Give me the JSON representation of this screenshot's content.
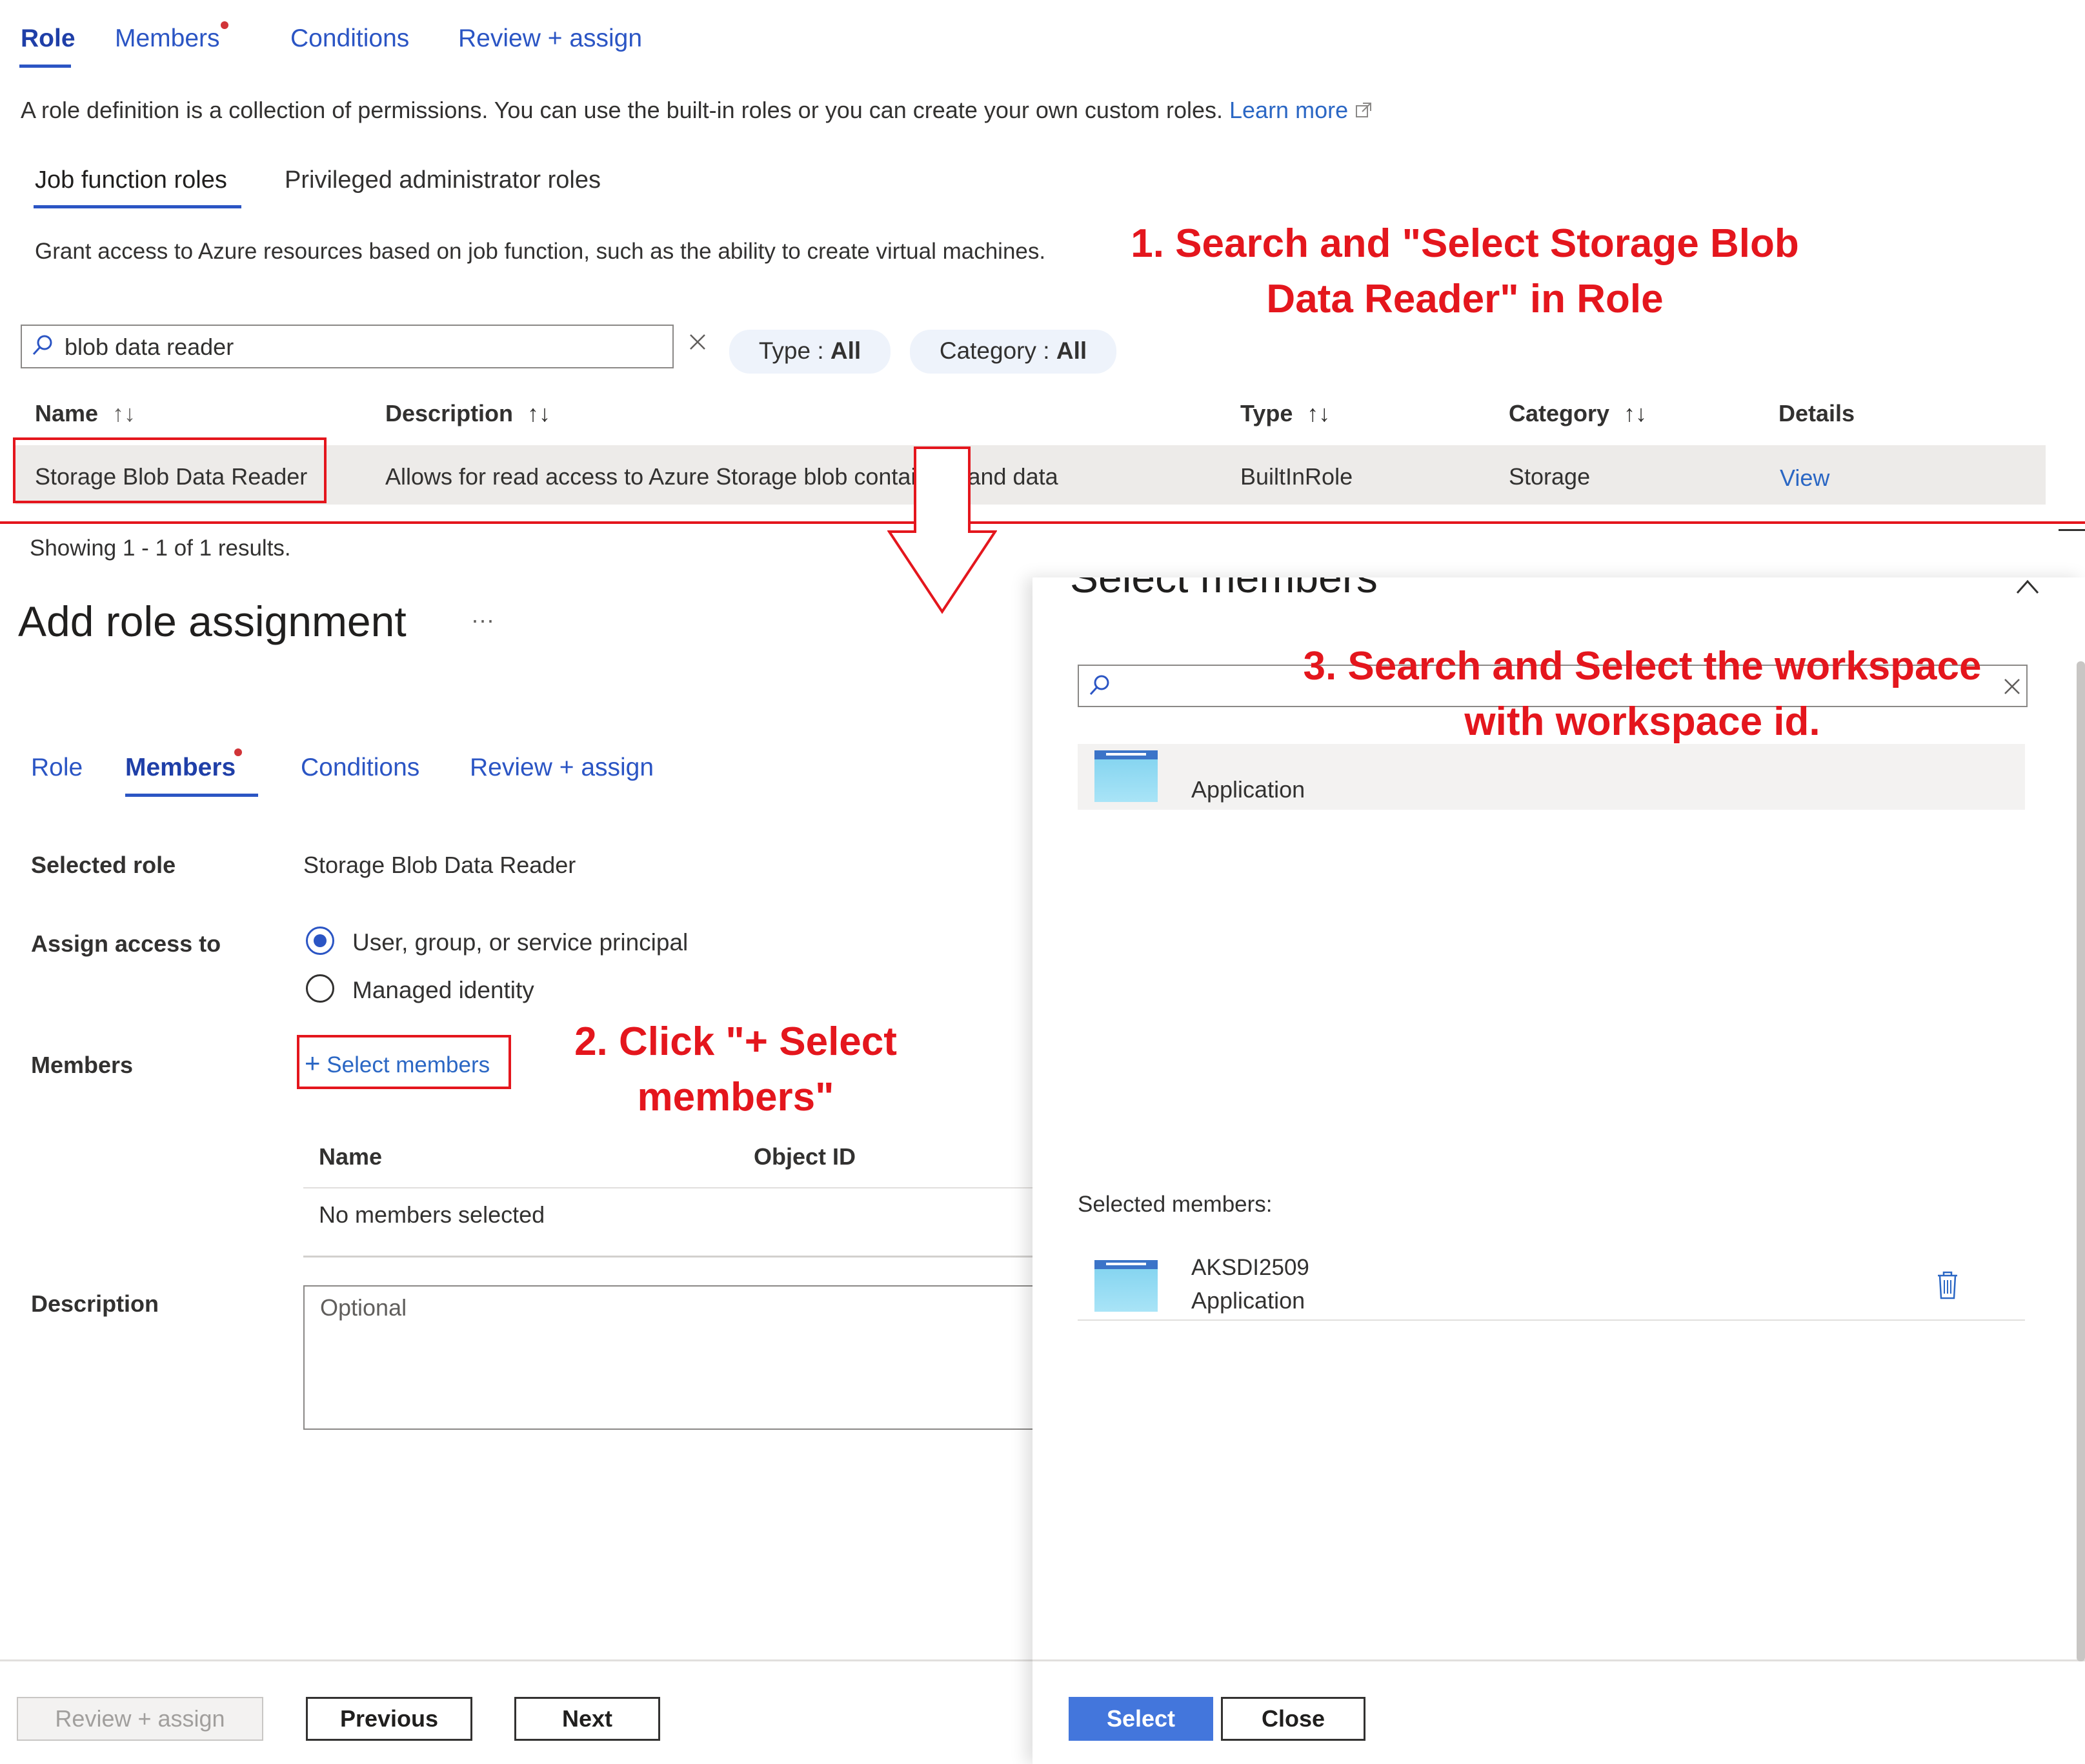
{
  "top_tabs": {
    "role": "Role",
    "members": "Members",
    "conditions": "Conditions",
    "review": "Review + assign"
  },
  "description": {
    "text": "A role definition is a collection of permissions. You can use the built-in roles or you can create your own custom roles.",
    "learn_more": "Learn more"
  },
  "role_tabs": {
    "job": "Job function roles",
    "privileged": "Privileged administrator roles"
  },
  "grant_text": "Grant access to Azure resources based on job function, such as the ability to create virtual machines.",
  "search": {
    "value": "blob data reader"
  },
  "filters": {
    "type_label": "Type : ",
    "type_value": "All",
    "category_label": "Category : ",
    "category_value": "All"
  },
  "table": {
    "headers": {
      "name": "Name",
      "description": "Description",
      "type": "Type",
      "category": "Category",
      "details": "Details"
    },
    "row": {
      "name": "Storage Blob Data Reader",
      "description": "Allows for read access to Azure Storage blob containers and data",
      "type": "BuiltInRole",
      "category": "Storage",
      "details": "View"
    },
    "showing": "Showing 1 - 1 of 1 results."
  },
  "annotations": {
    "step1_line1": "1. Search and \"Select Storage Blob",
    "step1_line2": "Data Reader\" in Role",
    "step2_line1": "2. Click \"+ Select",
    "step2_line2": "members\"",
    "step3_line1": "3. Search and Select the workspace",
    "step3_line2": "with workspace id."
  },
  "add_role": {
    "title": "Add role assignment",
    "more": "···",
    "tabs": {
      "role": "Role",
      "members": "Members",
      "conditions": "Conditions",
      "review": "Review + assign"
    },
    "selected_role_label": "Selected role",
    "selected_role_value": "Storage Blob Data Reader",
    "assign_access_label": "Assign access to",
    "option_user": "User, group, or service principal",
    "option_managed": "Managed identity",
    "members_label": "Members",
    "select_members": "Select members",
    "members_table": {
      "name": "Name",
      "object_id": "Object ID",
      "empty": "No members selected"
    },
    "description_label": "Description",
    "description_placeholder": "Optional",
    "buttons": {
      "review": "Review + assign",
      "previous": "Previous",
      "next": "Next"
    }
  },
  "select_panel": {
    "title": "Select members",
    "result_type": "Application",
    "selected_label": "Selected members:",
    "selected_name": "AKSDI2509",
    "selected_type": "Application",
    "buttons": {
      "select": "Select",
      "close": "Close"
    }
  },
  "colors": {
    "accent": "#2b55c4",
    "annotation": "#e4161d",
    "primary_button": "#4376dc"
  }
}
